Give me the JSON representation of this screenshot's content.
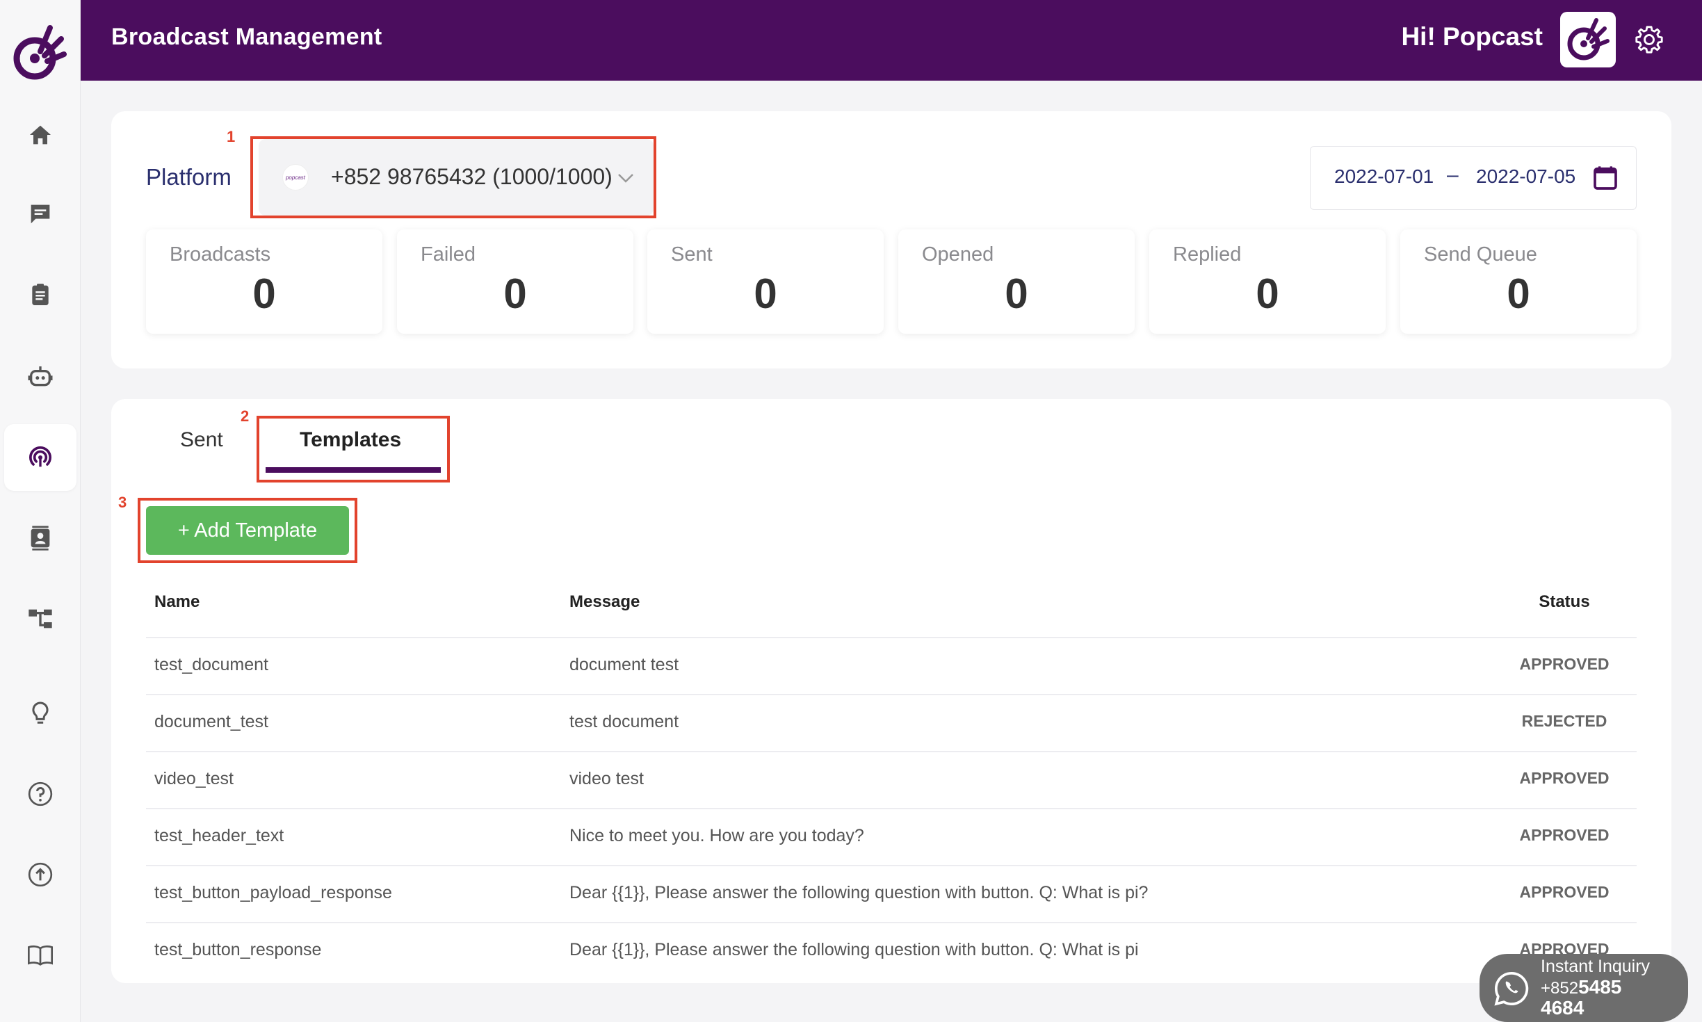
{
  "header": {
    "title": "Broadcast Management",
    "greeting": "Hi! Popcast"
  },
  "sidebar": {
    "items": [
      {
        "icon": "home-icon"
      },
      {
        "icon": "chat-icon"
      },
      {
        "icon": "clipboard-icon"
      },
      {
        "icon": "bot-icon"
      },
      {
        "icon": "broadcast-icon",
        "active": true
      },
      {
        "icon": "contacts-icon"
      },
      {
        "icon": "flow-icon"
      },
      {
        "icon": "lightbulb-icon"
      },
      {
        "icon": "help-icon"
      },
      {
        "icon": "upload-icon"
      },
      {
        "icon": "book-icon"
      }
    ]
  },
  "filters": {
    "platform_label": "Platform",
    "platform_value": "+852 98765432 (1000/1000)",
    "platform_logo_text": "popcast",
    "date_start": "2022-07-01",
    "date_separator": "–",
    "date_end": "2022-07-05"
  },
  "stats": [
    {
      "label": "Broadcasts",
      "value": "0"
    },
    {
      "label": "Failed",
      "value": "0"
    },
    {
      "label": "Sent",
      "value": "0"
    },
    {
      "label": "Opened",
      "value": "0"
    },
    {
      "label": "Replied",
      "value": "0"
    },
    {
      "label": "Send Queue",
      "value": "0"
    }
  ],
  "annotations": [
    "1",
    "2",
    "3"
  ],
  "tabs": {
    "sent": "Sent",
    "templates": "Templates"
  },
  "add_button": "+ Add Template",
  "table": {
    "headers": {
      "name": "Name",
      "message": "Message",
      "status": "Status"
    },
    "rows": [
      {
        "name": "test_document",
        "message": "document test",
        "status": "APPROVED"
      },
      {
        "name": "document_test",
        "message": "test document",
        "status": "REJECTED"
      },
      {
        "name": "video_test",
        "message": "video test",
        "status": "APPROVED"
      },
      {
        "name": "test_header_text",
        "message": "Nice to meet you. How are you today?",
        "status": "APPROVED"
      },
      {
        "name": "test_button_payload_response",
        "message": "Dear {{1}}, Please answer the following question with button. Q: What is pi?",
        "status": "APPROVED"
      },
      {
        "name": "test_button_response",
        "message": "Dear {{1}}, Please answer the following question with button. Q: What is pi",
        "status": "APPROVED"
      }
    ]
  },
  "whatsapp": {
    "line1": "Instant Inquiry",
    "prefix": "+852",
    "number_a": "5485",
    "number_b": "4684"
  },
  "colors": {
    "brand": "#4b0d5e",
    "accent_green": "#5cb85c",
    "annotation_red": "#e2432d"
  }
}
